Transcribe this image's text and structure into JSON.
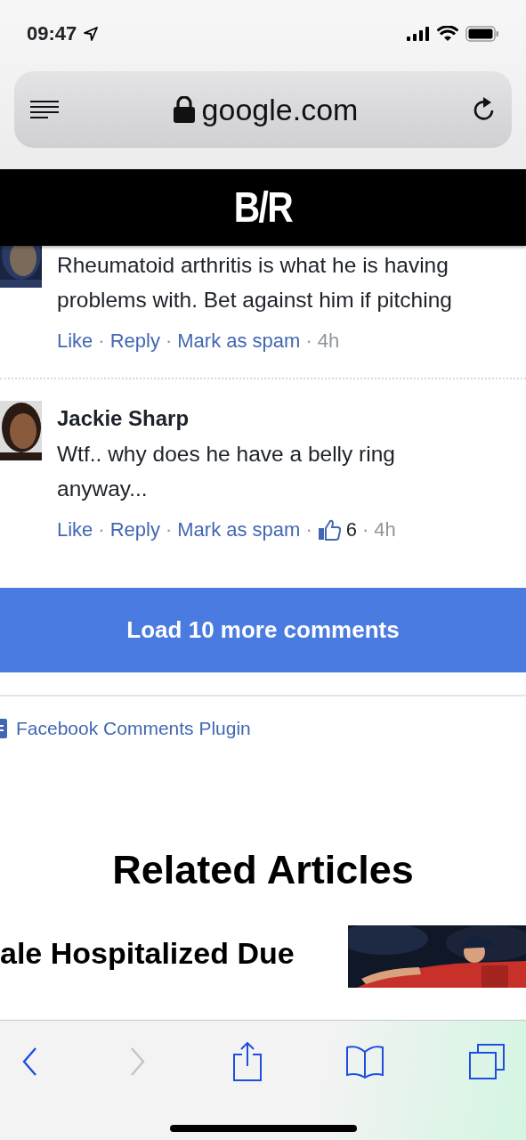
{
  "status_bar": {
    "time": "09:47"
  },
  "address_bar": {
    "url": "google.com"
  },
  "site_header": {
    "logo": "B/R"
  },
  "comments": [
    {
      "lines": [
        "Rheumatoid arthritis is what he is having",
        "problems with. Bet against him if pitching"
      ],
      "actions": [
        "Like",
        "Reply",
        "Mark as spam"
      ],
      "separator": "·",
      "time": "4h"
    },
    {
      "author": "Jackie Sharp",
      "lines": [
        "Wtf.. why does he have a belly ring",
        "anyway..."
      ],
      "actions": [
        "Like",
        "Reply",
        "Mark as spam"
      ],
      "separator": "·",
      "likes": "6",
      "time": "4h"
    }
  ],
  "load_more": {
    "label": "Load 10 more comments"
  },
  "plugin_link": {
    "label": "Facebook Comments Plugin"
  },
  "related": {
    "heading": "Related Articles",
    "article": {
      "title_lines": [
        "ale Hospitalized Due"
      ],
      "kind": "picture"
    }
  },
  "toolbar": [
    {
      "kind": "back",
      "disabled": false
    },
    {
      "kind": "forward",
      "disabled": true
    },
    {
      "kind": "share",
      "disabled": false
    },
    {
      "kind": "bookmarks",
      "disabled": false
    },
    {
      "kind": "tabs",
      "disabled": false
    }
  ]
}
